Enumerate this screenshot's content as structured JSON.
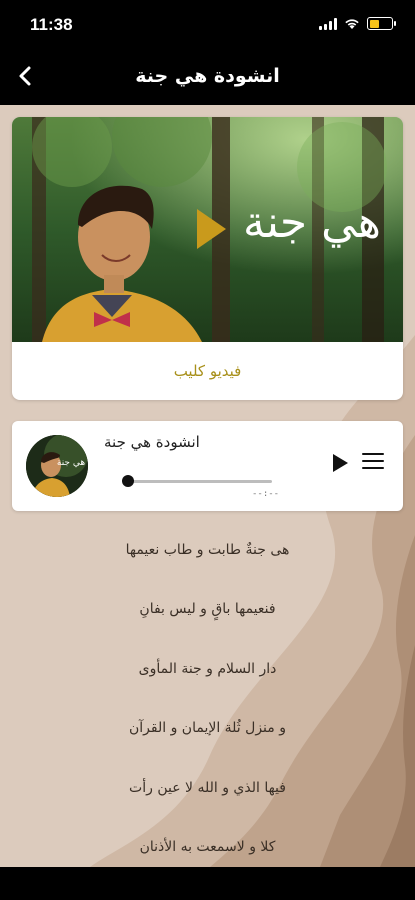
{
  "status_bar": {
    "time": "11:38"
  },
  "header": {
    "title": "انشودة هي جنة"
  },
  "video": {
    "label": "فيديو كليب",
    "thumb_title": "هي جنة"
  },
  "player": {
    "track_title": "انشودة هي جنة",
    "time": "--:--"
  },
  "lyrics": [
    "هى جنةٌ طابت و طاب نعيمها",
    "فنعيمها باقٍ و ليس بفانِ",
    "دار السلام و جنة المأوى",
    "و منزل ثُلة الإيمان و القرآن",
    "فيها الذي و الله لا عين رأت",
    "كلا و لاسمعت به الأذنان"
  ],
  "colors": {
    "accent_gold": "#a8901a",
    "background": "#d8c7b8"
  }
}
